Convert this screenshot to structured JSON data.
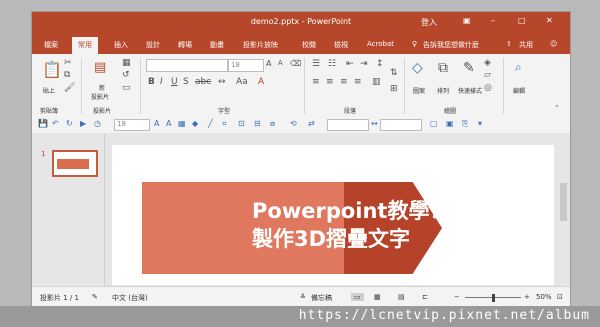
{
  "window": {
    "title": "demo2.pptx - PowerPoint",
    "login": "登入",
    "ribbon_display": "▣",
    "minimize": "–",
    "maximize": "□",
    "close": "✕"
  },
  "tabs": [
    "檔案",
    "常用",
    "插入",
    "設計",
    "轉場",
    "動畫",
    "投影片放映",
    "校閱",
    "檢視",
    "Acrobat"
  ],
  "active_tab": "常用",
  "tell_me": "告訴我您想做什麼",
  "share": "共用",
  "ribbon": {
    "clipboard": {
      "paste": "貼上",
      "label": "剪貼簿"
    },
    "slides": {
      "new_slide": "新",
      "new_slide2": "投影片",
      "label": "投影片"
    },
    "font": {
      "size": "18",
      "label": "字型"
    },
    "paragraph": {
      "label": "段落"
    },
    "drawing": {
      "shapes": "圖案",
      "arrange": "排列",
      "quick_styles": "快速樣式",
      "label": "繪圖"
    },
    "editing": {
      "edit": "編輯"
    }
  },
  "qat": {
    "font_size": "18"
  },
  "slides_pane": {
    "slide_number": "1"
  },
  "slide": {
    "title_line1": "Powerpoint教學：",
    "title_line2": "製作3D摺疊文字",
    "colors": {
      "light": "#e0785f",
      "dark": "#b4432a"
    }
  },
  "status": {
    "slide_info": "投影片 1 / 1",
    "language": "中文 (台灣)",
    "notes": "備忘稿",
    "zoom": "50%",
    "zoom_minus": "−",
    "zoom_plus": "+"
  },
  "watermark": "https://lcnetvip.pixnet.net/album",
  "brand_color": "#b7472a"
}
